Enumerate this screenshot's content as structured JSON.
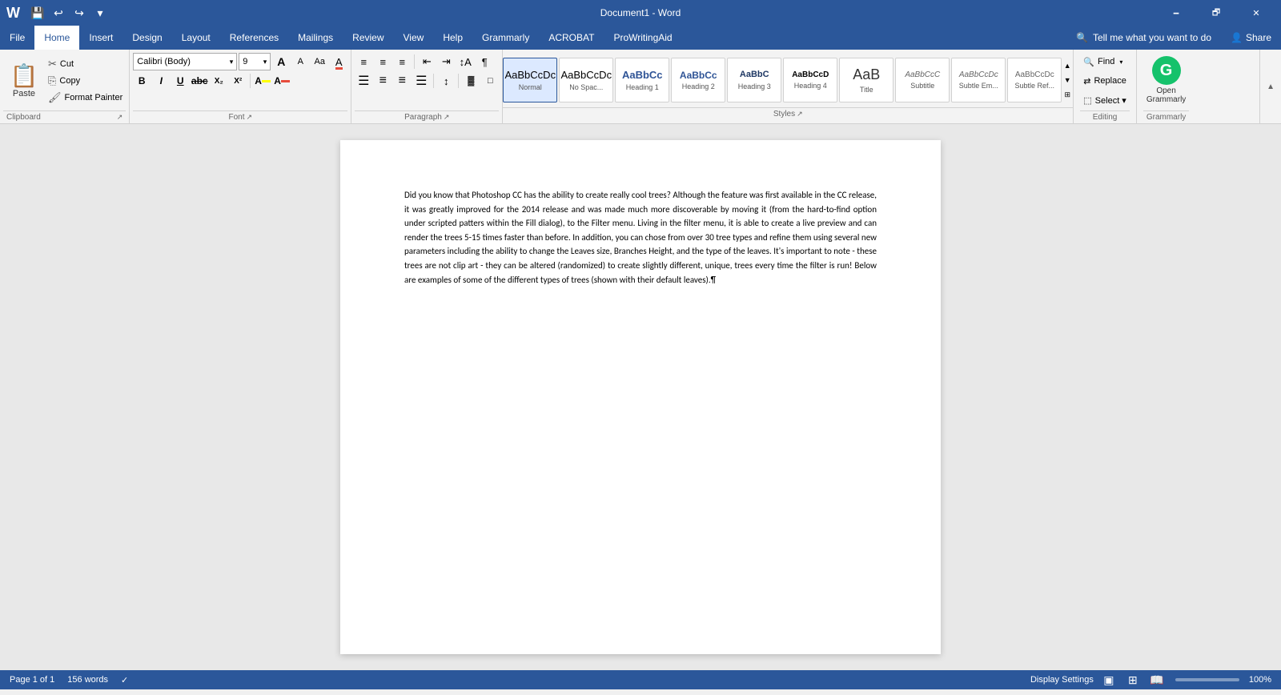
{
  "titlebar": {
    "title": "Document1  -  Word",
    "minimize": "🗕",
    "restore": "🗗",
    "close": "✕",
    "save_icon": "💾",
    "undo_icon": "↩",
    "redo_icon": "↪",
    "customize_icon": "▾"
  },
  "menu": {
    "items": [
      "File",
      "Home",
      "Insert",
      "Design",
      "Layout",
      "References",
      "Mailings",
      "Review",
      "View",
      "Help",
      "Grammarly",
      "ACROBAT",
      "ProWritingAid"
    ],
    "active": "Home",
    "search_placeholder": "Tell me what you want to do",
    "share_label": "Share"
  },
  "ribbon": {
    "clipboard": {
      "paste_label": "Paste",
      "cut_label": "Cut",
      "copy_label": "Copy",
      "format_painter_label": "Format Painter",
      "group_label": "Clipboard"
    },
    "font": {
      "font_name": "Calibri (Body)",
      "font_size": "9",
      "grow_label": "A",
      "shrink_label": "A",
      "case_label": "Aa",
      "clear_label": "A",
      "bold_label": "B",
      "italic_label": "I",
      "underline_label": "U",
      "strikethrough_label": "abc",
      "subscript_label": "X₂",
      "superscript_label": "X²",
      "highlight_label": "A",
      "font_color_label": "A",
      "group_label": "Font"
    },
    "paragraph": {
      "bullets_label": "≡",
      "numbering_label": "≡",
      "multilevel_label": "≡",
      "decrease_indent": "⇤",
      "increase_indent": "⇥",
      "sort_label": "↕",
      "show_marks_label": "¶",
      "align_left": "≡",
      "align_center": "≡",
      "align_right": "≡",
      "justify": "≡",
      "line_spacing": "↕",
      "shading": "▓",
      "borders": "□",
      "group_label": "Paragraph"
    },
    "styles": {
      "items": [
        {
          "label": "Normal",
          "preview": "AaBbCcDc",
          "class": "style-normal",
          "active": true
        },
        {
          "label": "No Spac...",
          "preview": "AaBbCcDc",
          "class": "style-nospace"
        },
        {
          "label": "Heading 1",
          "preview": "AaBbCc",
          "class": "style-h1"
        },
        {
          "label": "Heading 2",
          "preview": "AaBbCc",
          "class": "style-h2"
        },
        {
          "label": "Heading 3",
          "preview": "AaBbC",
          "class": "style-h3"
        },
        {
          "label": "Heading 4",
          "preview": "AaBbCcD",
          "class": "style-h4"
        },
        {
          "label": "Title",
          "preview": "AaB",
          "class": "style-title"
        },
        {
          "label": "Subtitle",
          "preview": "AaBbCcC",
          "class": "style-subtitle"
        },
        {
          "label": "Subtle Em...",
          "preview": "AaBbCcDc",
          "class": "style-subtle-em"
        },
        {
          "label": "Subtle Ref...",
          "preview": "AaBbCcDc",
          "class": "style-subtle-ref"
        }
      ],
      "group_label": "Styles"
    },
    "editing": {
      "find_label": "Find",
      "replace_label": "Replace",
      "select_label": "Select ▾",
      "group_label": "Editing"
    },
    "grammarly": {
      "label": "Open\nGrammarly",
      "group_label": "Grammarly"
    }
  },
  "document": {
    "content": "Did you know that Photoshop CC has the ability to create really cool trees? Although the feature was first available in the CC release, it was greatly improved for the 2014 release and was made much more discoverable by moving it (from the hard-to-find option under scripted patters within the Fill dialog), to the Filter menu. Living in the filter menu, it is able to create a live preview and can render the trees 5-15 times faster than before. In addition, you can chose from over 30 tree types and refine them using several new parameters including the ability to change the Leaves size, Branches Height, and the type of the leaves. It's important to note - these trees are not clip art - they can be altered (randomized) to create slightly different, unique, trees every time the filter is run! Below are examples of some of the different types of trees (shown with their default leaves).¶"
  },
  "statusbar": {
    "page_info": "Page 1 of 1",
    "word_count": "156 words",
    "proofing_icon": "✓",
    "zoom_level": "100%",
    "display_settings": "Display Settings"
  },
  "colors": {
    "ribbon_bg": "#2b579a",
    "ribbon_active": "#ffffff",
    "accent": "#2b579a",
    "grammarly": "#15c26b"
  }
}
